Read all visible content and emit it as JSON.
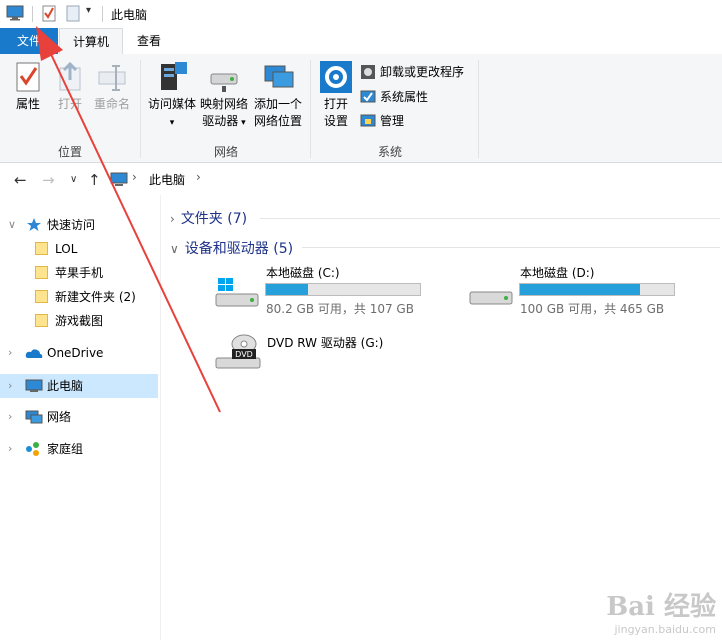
{
  "window": {
    "title": "此电脑"
  },
  "ribbon": {
    "tabs": [
      {
        "label": "文件"
      },
      {
        "label": "计算机"
      },
      {
        "label": "查看"
      }
    ],
    "location": {
      "label": "位置",
      "properties": "属性",
      "open": "打开",
      "rename": "重命名"
    },
    "network": {
      "label": "网络",
      "access_media": "访问媒体",
      "map_drive_1": "映射网络",
      "map_drive_2": "驱动器",
      "add_location_1": "添加一个",
      "add_location_2": "网络位置"
    },
    "system": {
      "label": "系统",
      "open_settings_1": "打开",
      "open_settings_2": "设置",
      "uninstall": "卸载或更改程序",
      "sys_props": "系统属性",
      "manage": "管理"
    }
  },
  "address": {
    "path": "此电脑"
  },
  "nav": {
    "quick_access": "快速访问",
    "folders": [
      "LOL",
      "苹果手机",
      "新建文件夹 (2)",
      "游戏截图"
    ],
    "onedrive": "OneDrive",
    "this_pc": "此电脑",
    "network": "网络",
    "homegroup": "家庭组"
  },
  "content": {
    "folders_header": "文件夹 (7)",
    "devices_header": "设备和驱动器 (5)",
    "drives": [
      {
        "name": "本地磁盘 (C:)",
        "info": "80.2 GB 可用，共 107 GB",
        "used_fraction": 0.27
      },
      {
        "name": "本地磁盘 (D:)",
        "info": "100 GB 可用，共 465 GB",
        "used_fraction": 0.78
      },
      {
        "name": "DVD RW 驱动器 (G:)"
      }
    ],
    "dvd_badge": "DVD"
  },
  "watermark": {
    "brand": "Bai 经验",
    "url": "jingyan.baidu.com"
  },
  "colors": {
    "accent": "#1979ca",
    "drive_bar": "#26a0da",
    "arrow": "#e8403a",
    "selection": "#cce8ff"
  },
  "icons": [
    "computer-icon",
    "check-icon",
    "page-icon",
    "properties-icon",
    "open-icon",
    "rename-icon",
    "media-icon",
    "map-drive-icon",
    "network-location-icon",
    "gear-icon",
    "uninstall-icon",
    "system-properties-icon",
    "manage-icon",
    "star-icon",
    "folder-icon",
    "onedrive-icon",
    "pc-icon",
    "network-icon",
    "homegroup-icon",
    "windows-drive-icon",
    "hdd-icon",
    "dvd-icon"
  ]
}
